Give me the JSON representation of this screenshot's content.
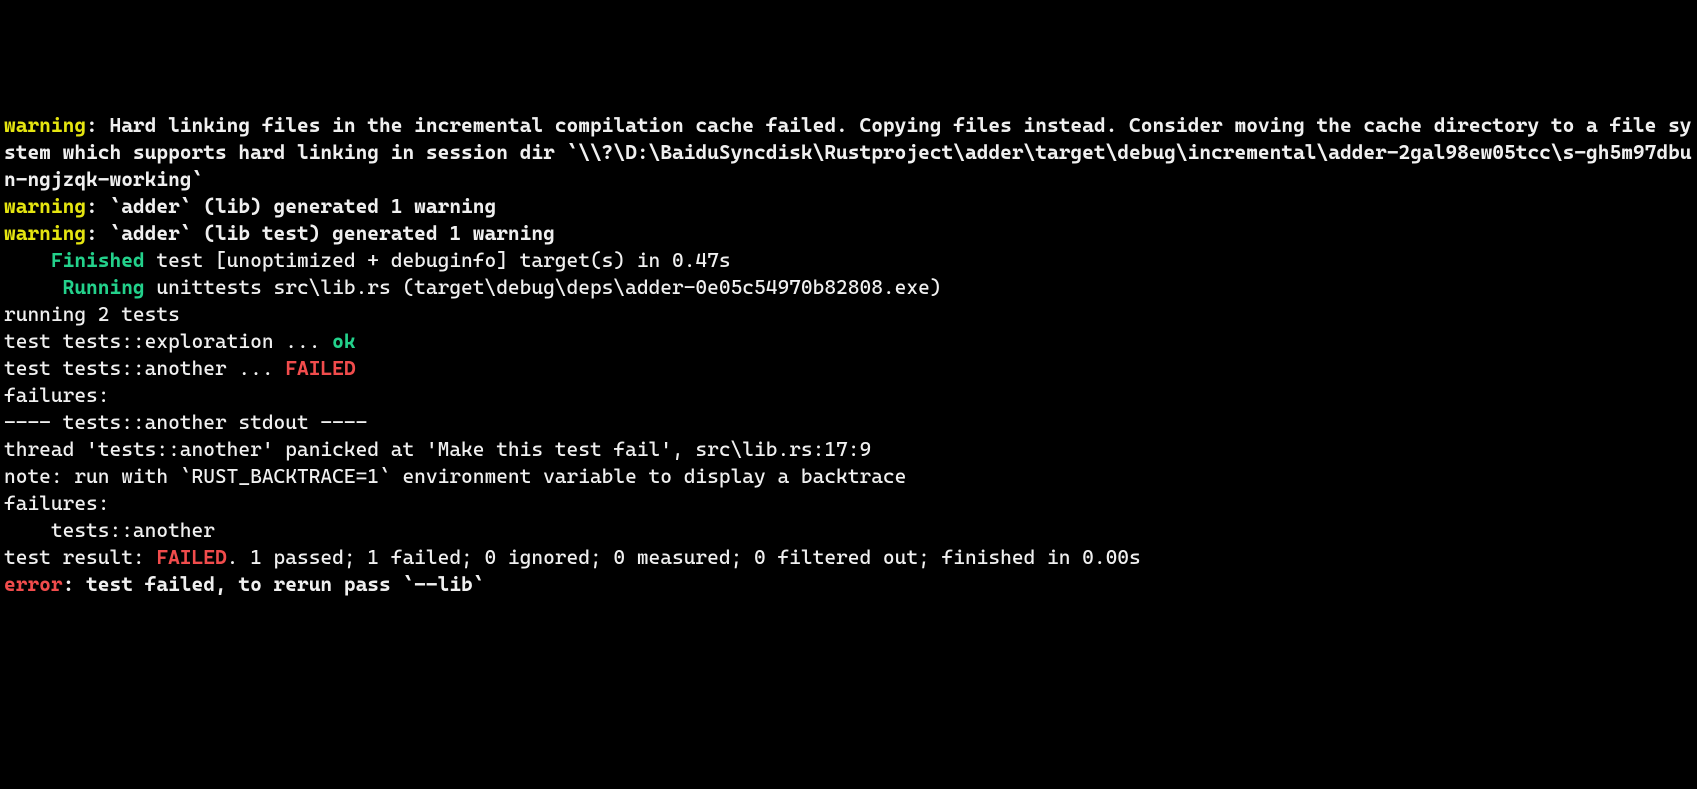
{
  "warn1_label": "warning",
  "warn1_colon": ": ",
  "warn1_text": "Hard linking files in the incremental compilation cache failed. Copying files instead. Consider moving the cache directory to a file system which supports hard linking in session dir `\\\\?\\D:\\BaiduSyncdisk\\Rustproject\\adder\\target\\debug\\incremental\\adder-2gal98ew05tcc\\s-gh5m97dbun-ngjzqk-working`",
  "blank": "",
  "warn2_label": "warning",
  "warn2_text": ": `adder` (lib) generated 1 warning",
  "warn3_label": "warning",
  "warn3_text": ": `adder` (lib test) generated 1 warning",
  "finished_pad": "    ",
  "finished_label": "Finished",
  "finished_text": " test [unoptimized + debuginfo] target(s) in 0.47s",
  "running_pad": "     ",
  "running_label": "Running",
  "running_text": " unittests src\\lib.rs (target\\debug\\deps\\adder-0e05c54970b82808.exe)",
  "running_tests": "running 2 tests",
  "test1_prefix": "test tests::exploration ... ",
  "test1_status": "ok",
  "test2_prefix": "test tests::another ... ",
  "test2_status": "FAILED",
  "failures_header": "failures:",
  "stdout_header": "---- tests::another stdout ----",
  "panic_line": "thread 'tests::another' panicked at 'Make this test fail', src\\lib.rs:17:9",
  "note_line": "note: run with `RUST_BACKTRACE=1` environment variable to display a backtrace",
  "failures_header2": "failures:",
  "failed_test": "    tests::another",
  "result_prefix": "test result: ",
  "result_status": "FAILED",
  "result_suffix": ". 1 passed; 1 failed; 0 ignored; 0 measured; 0 filtered out; finished in 0.00s",
  "error_label": "error",
  "error_text": ": test failed, to rerun pass `--lib`"
}
